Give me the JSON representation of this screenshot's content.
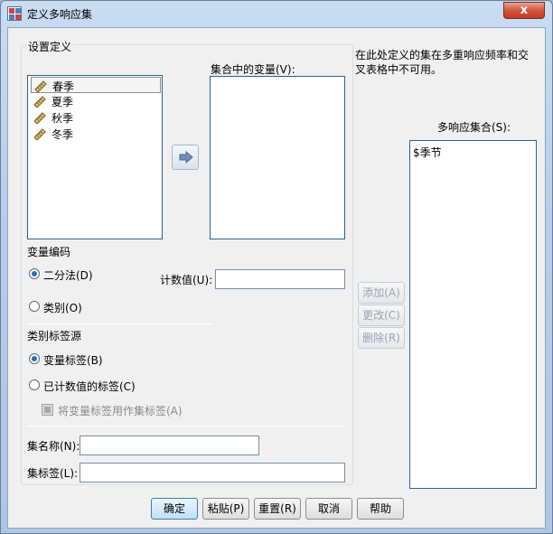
{
  "window": {
    "title": "定义多响应集",
    "close_glyph": "x"
  },
  "info_text_line1": "在此处定义的集在多重响应频率和交",
  "info_text_line2": "叉表格中不可用。",
  "set_definition": {
    "legend": "设置定义",
    "source_variables": [
      "春季",
      "夏季",
      "秋季",
      "冬季"
    ],
    "source_icon": "ruler-icon",
    "move_button_icon": "arrow-right-icon",
    "target_label": "集合中的变量(V):",
    "target_variables": [],
    "encoding": {
      "title": "变量编码",
      "dichotomy_label": "二分法(D)",
      "dichotomy_selected": true,
      "count_value_label": "计数值(U):",
      "count_value": "",
      "category_label": "类别(O)",
      "category_selected": false
    },
    "category_label_source": {
      "title": "类别标签源",
      "variable_labels": "变量标签(B)",
      "variable_labels_selected": true,
      "counted_value_labels": "已计数值的标签(C)",
      "counted_value_labels_selected": false,
      "use_var_label_as_set_label": "将变量标签用作集标签(A)",
      "use_var_label_checked": false
    },
    "set_name_label": "集名称(N):",
    "set_name_value": "",
    "set_label_label": "集标签(L):",
    "set_label_value": ""
  },
  "multi_response_sets": {
    "label": "多响应集合(S):",
    "items": [
      "$季节"
    ]
  },
  "side_buttons": {
    "add": "添加(A)",
    "change": "更改(C)",
    "delete": "删除(R)"
  },
  "footer_buttons": {
    "ok": "确定",
    "paste": "粘贴(P)",
    "reset": "重置(R)",
    "cancel": "取消",
    "help": "帮助"
  },
  "colors": {
    "accent": "#2f6db3",
    "close_red": "#c53a22"
  }
}
